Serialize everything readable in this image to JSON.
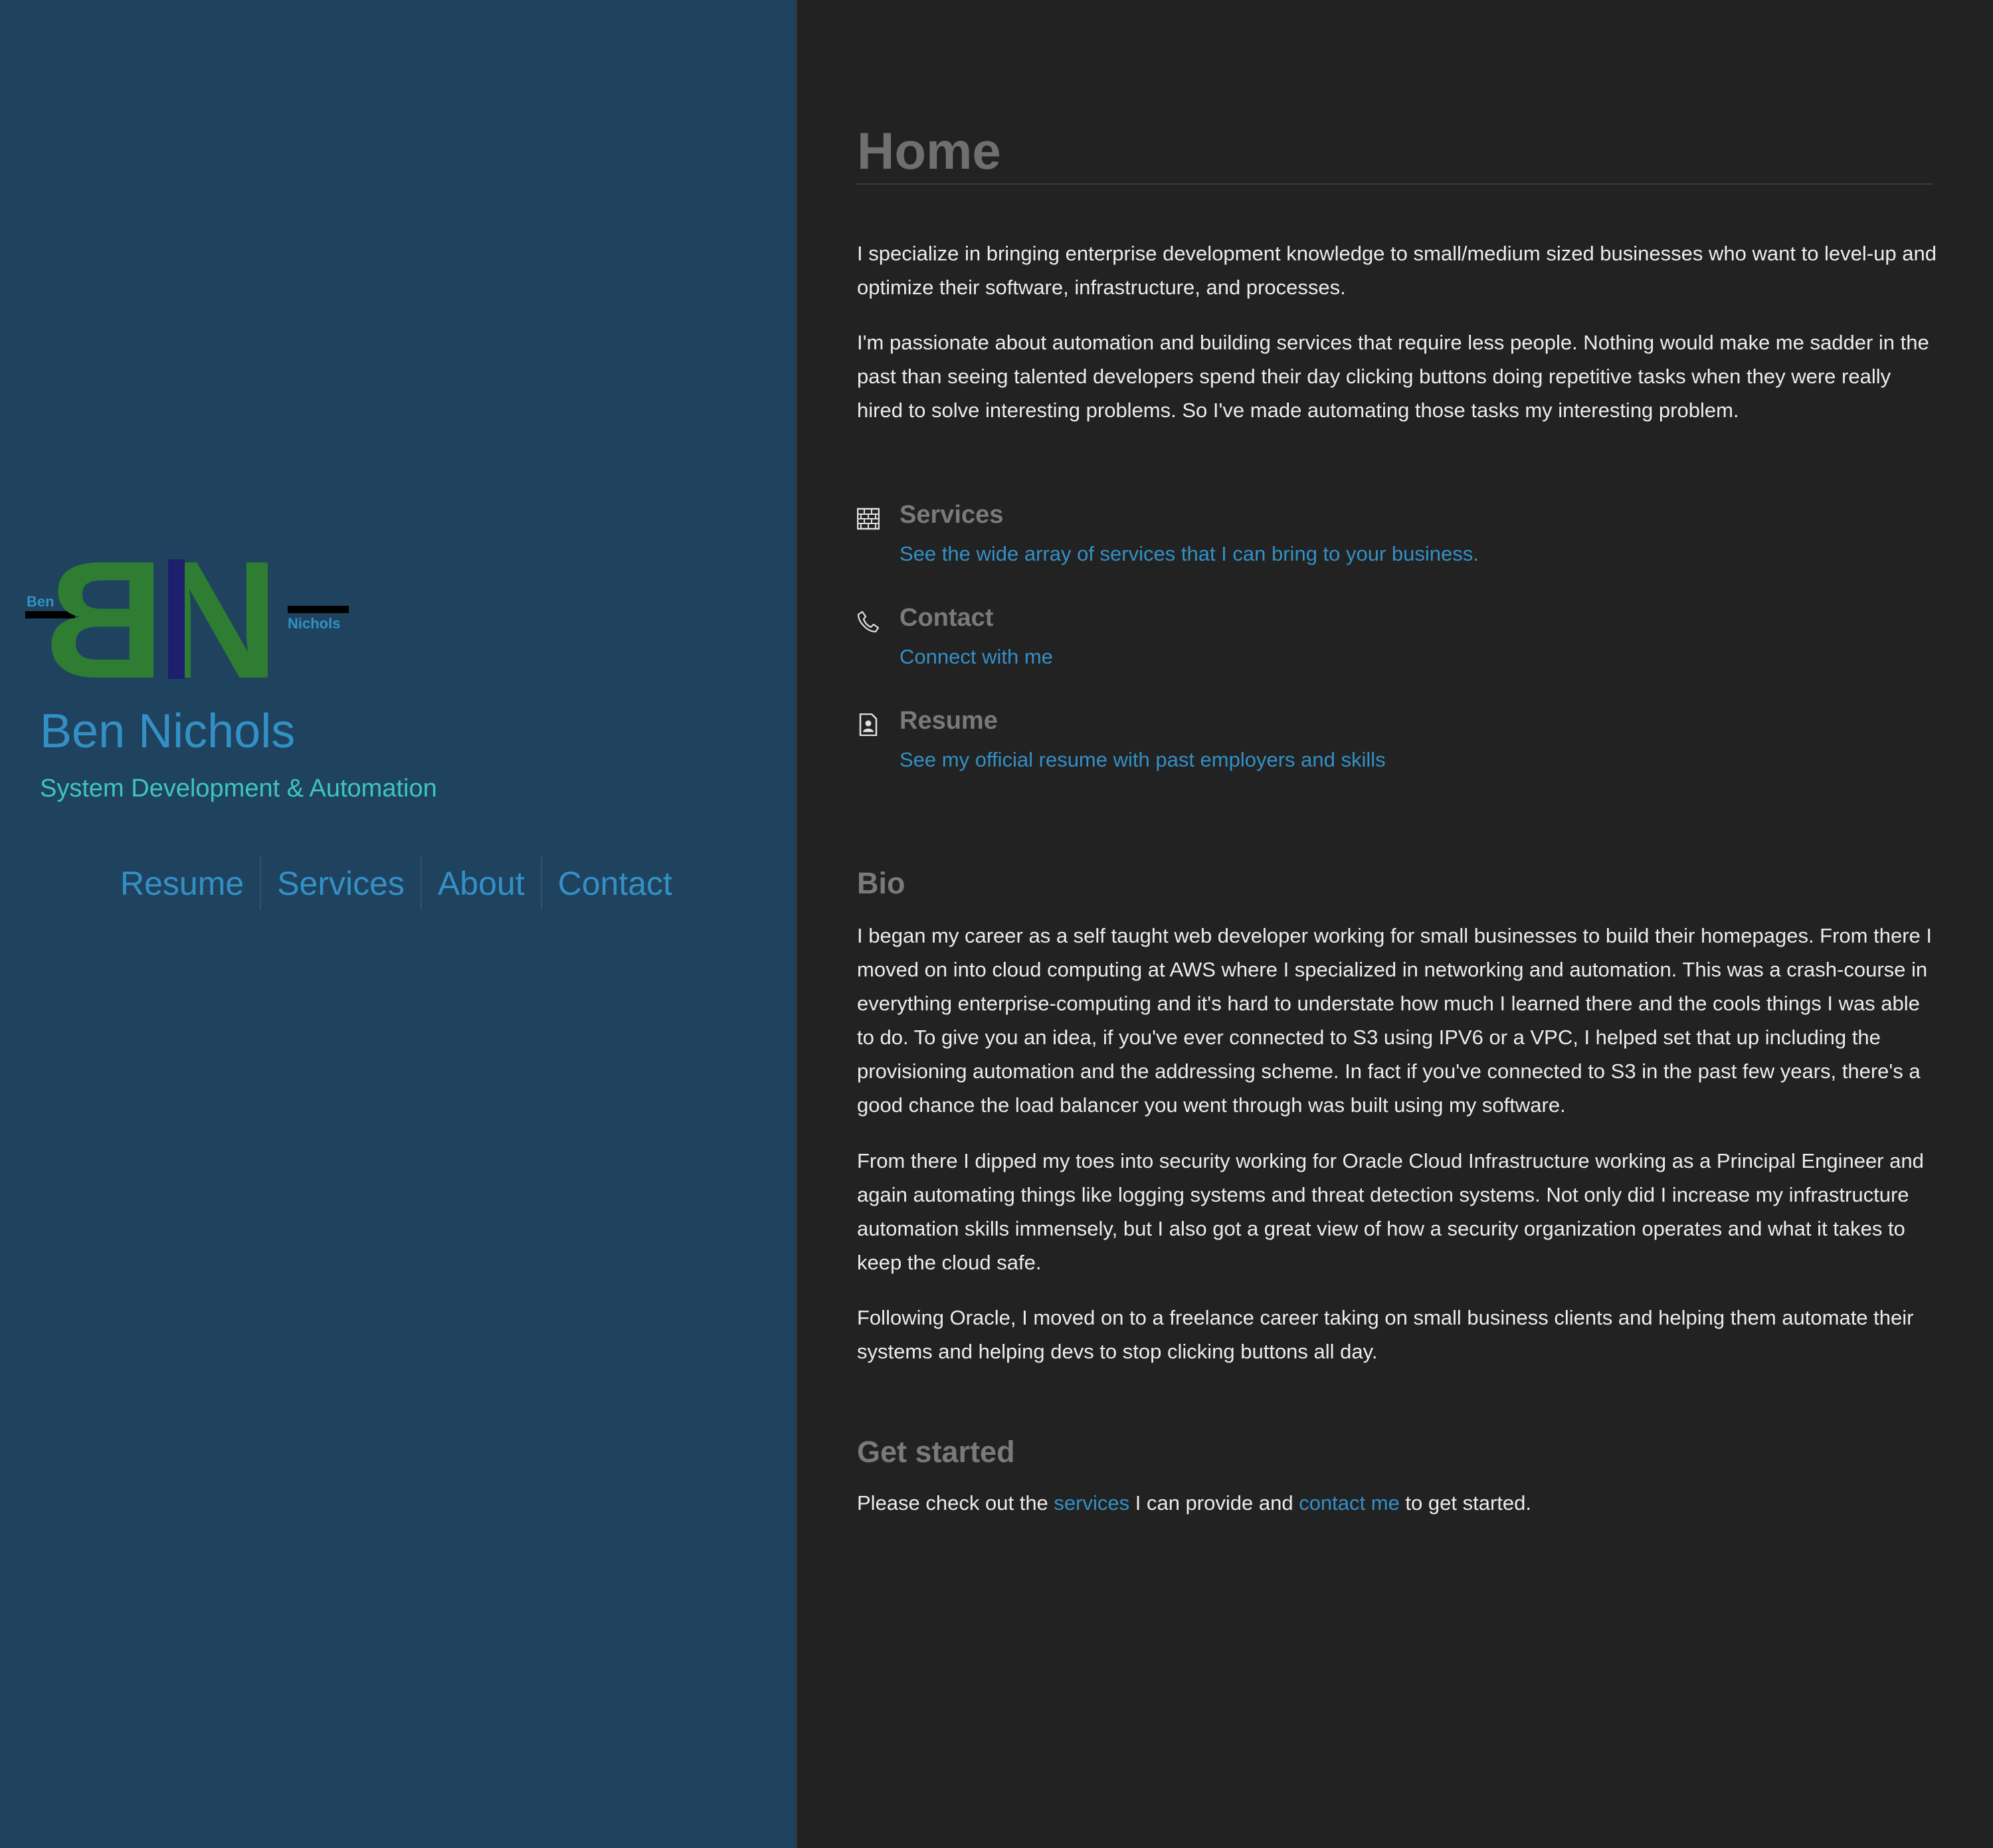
{
  "logo": {
    "big_letters": "BN",
    "left_name": "Ben",
    "right_name": "Nichols",
    "colors": {
      "letters": "#2e7d32",
      "bar": "#1e1e6e",
      "name": "#3390c6",
      "rule": "#000000"
    }
  },
  "sidebar": {
    "title": "Ben Nichols",
    "tagline": "System Development & Automation",
    "nav": [
      {
        "label": "Resume"
      },
      {
        "label": "Services"
      },
      {
        "label": "About"
      },
      {
        "label": "Contact"
      }
    ]
  },
  "main": {
    "title": "Home",
    "intro": [
      "I specialize in bringing enterprise development knowledge to small/medium sized businesses who want to level-up and optimize their software, infrastructure, and processes.",
      "I'm passionate about automation and building services that require less people. Nothing would make me sadder in the past than seeing talented developers spend their day clicking buttons doing repetitive tasks when they were really hired to solve interesting problems. So I've made automating those tasks my interesting problem."
    ],
    "links": [
      {
        "icon": "building-icon",
        "title": "Services",
        "desc": "See the wide array of services that I can bring to your business."
      },
      {
        "icon": "phone-icon",
        "title": "Contact",
        "desc": "Connect with me"
      },
      {
        "icon": "resume-icon",
        "title": "Resume",
        "desc": "See my official resume with past employers and skills"
      }
    ],
    "bio": {
      "heading": "Bio",
      "paragraphs": [
        "I began my career as a self taught web developer working for small businesses to build their homepages. From there I moved on into cloud computing at AWS where I specialized in networking and automation. This was a crash-course in everything enterprise-computing and it's hard to understate how much I learned there and the cools things I was able to do. To give you an idea, if you've ever connected to S3 using IPV6 or a VPC, I helped set that up including the provisioning automation and the addressing scheme. In fact if you've connected to S3 in the past few years, there's a good chance the load balancer you went through was built using my software.",
        "From there I dipped my toes into security working for Oracle Cloud Infrastructure working as a Principal Engineer and again automating things like logging systems and threat detection systems. Not only did I increase my infrastructure automation skills immensely, but I also got a great view of how a security organization operates and what it takes to keep the cloud safe.",
        "Following Oracle, I moved on to a freelance career taking on small business clients and helping them automate their systems and helping devs to stop clicking buttons all day."
      ]
    },
    "get_started": {
      "heading": "Get started",
      "text_before": "Please check out the ",
      "link1": "services",
      "text_middle": " I can provide and ",
      "link2": "contact me",
      "text_after": " to get started."
    }
  },
  "colors": {
    "sidebar_bg": "#1f435f",
    "main_bg": "#222222",
    "accent": "#3390c6",
    "tagline": "#3fc4c0"
  }
}
